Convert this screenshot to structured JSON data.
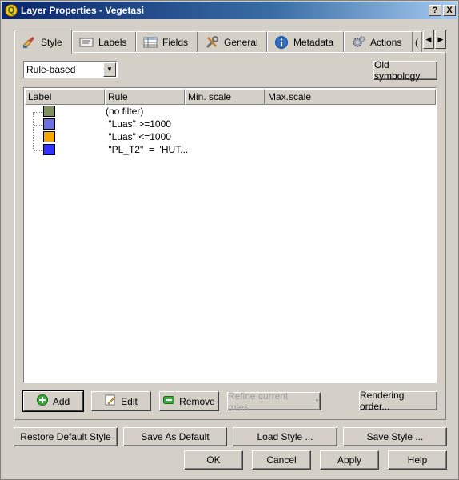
{
  "window": {
    "title": "Layer Properties - Vegetasi",
    "help_button": "?",
    "close_button": "X"
  },
  "tabs": [
    {
      "label": "Style",
      "icon": "style-icon",
      "active": true
    },
    {
      "label": "Labels",
      "icon": "labels-icon",
      "active": false
    },
    {
      "label": "Fields",
      "icon": "fields-icon",
      "active": false
    },
    {
      "label": "General",
      "icon": "general-icon",
      "active": false
    },
    {
      "label": "Metadata",
      "icon": "metadata-icon",
      "active": false
    },
    {
      "label": "Actions",
      "icon": "actions-icon",
      "active": false
    }
  ],
  "style_page": {
    "renderer": "Rule-based",
    "old_symbology_label": "Old symbology",
    "columns": [
      "Label",
      "Rule",
      "Min. scale",
      "Max.scale"
    ],
    "rules": [
      {
        "label": "",
        "rule": "(no filter)",
        "color": "#7f9160"
      },
      {
        "label": "",
        "rule": " \"Luas\" >=1000",
        "color": "#6b72e0"
      },
      {
        "label": "",
        "rule": " \"Luas\" <=1000",
        "color": "#f5a800"
      },
      {
        "label": "",
        "rule": " \"PL_T2\"  =  'HUT...",
        "color": "#3333ff"
      }
    ],
    "buttons": {
      "add": "Add",
      "edit": "Edit",
      "remove": "Remove",
      "refine": "Refine current rules",
      "rendering_order": "Rendering order..."
    }
  },
  "dialog_buttons": {
    "restore_default": "Restore Default Style",
    "save_as_default": "Save As Default",
    "load_style": "Load Style ...",
    "save_style": "Save Style ...",
    "ok": "OK",
    "cancel": "Cancel",
    "apply": "Apply",
    "help": "Help"
  },
  "colors": {
    "titlebar_start": "#0a246a",
    "titlebar_end": "#a6caf0",
    "dialog_bg": "#d4d0c8"
  }
}
